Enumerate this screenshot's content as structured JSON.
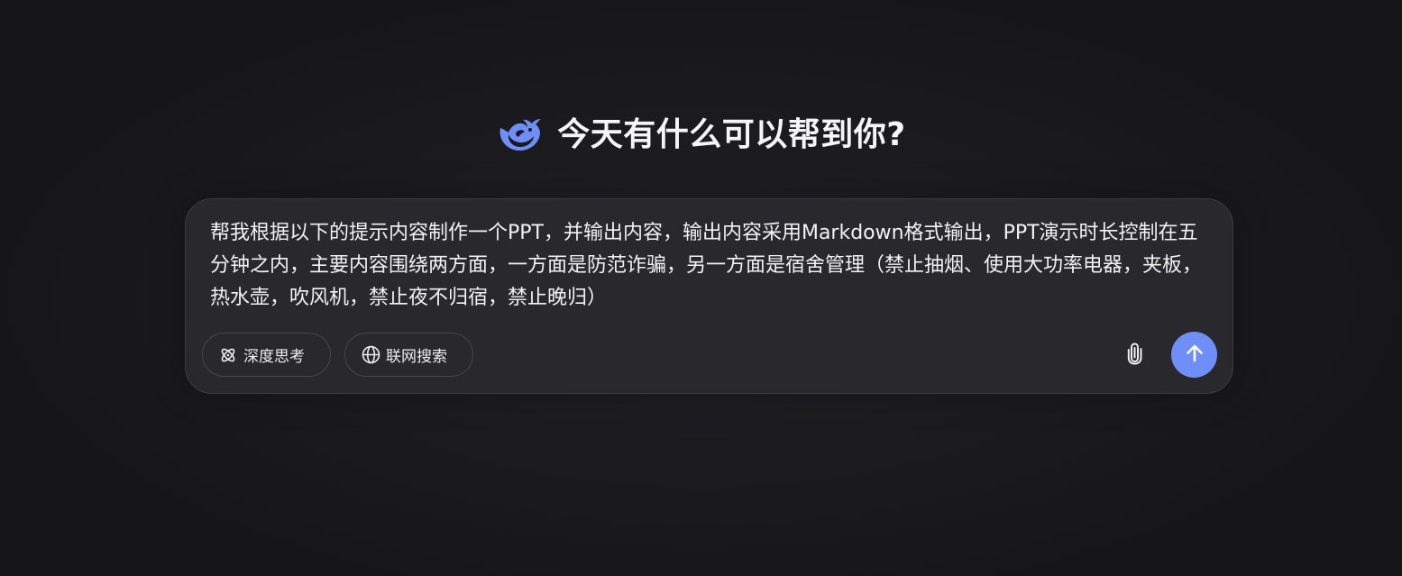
{
  "header": {
    "title": "今天有什么可以帮到你?",
    "logo_icon": "whale-logo-icon"
  },
  "composer": {
    "prompt_text": "帮我根据以下的提示内容制作一个PPT，并输出内容，输出内容采用Markdown格式输出，PPT演示时长控制在五分钟之内，主要内容围绕两方面，一方面是防范诈骗，另一方面是宿舍管理（禁止抽烟、使用大功率电器，夹板，热水壶，吹风机，禁止夜不归宿，禁止晚归）",
    "deep_think_label": "深度思考",
    "deep_think_icon": "atom-icon",
    "web_search_label": "联网搜索",
    "web_search_icon": "globe-icon",
    "attach_icon": "paperclip-icon",
    "send_icon": "arrow-up-icon"
  },
  "colors": {
    "accent": "#6f8ef7",
    "background": "#1b1b1e",
    "composer_bg": "#29292d"
  }
}
